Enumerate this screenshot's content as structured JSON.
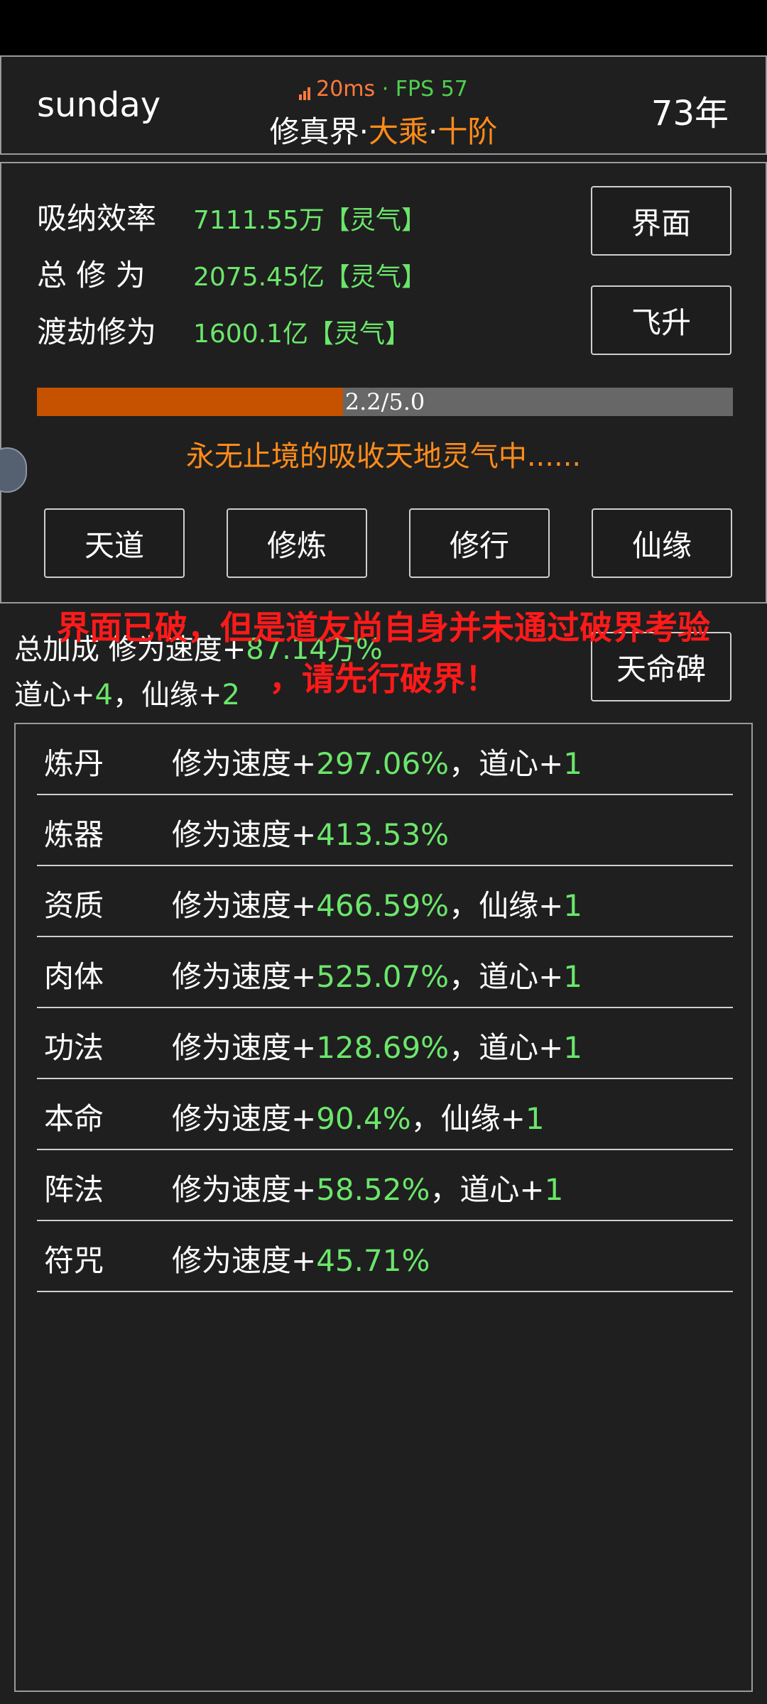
{
  "header": {
    "player_name": "sunday",
    "latency": "20ms",
    "fps_text": "· FPS 57",
    "realm_world": "修真界",
    "sep": "·",
    "realm_stage": "大乘",
    "realm_level": "十阶",
    "year": "73年"
  },
  "stats": [
    {
      "label": "吸纳效率",
      "value": "7111.55万【灵气】"
    },
    {
      "label": "总 修 为",
      "value": "2075.45亿【灵气】"
    },
    {
      "label": "渡劫修为",
      "value": "1600.1亿【灵气】"
    }
  ],
  "buttons": {
    "interface": "界面",
    "ascend": "飞升",
    "tiandao": "天道",
    "cultivate": "修炼",
    "practice": "修行",
    "fate": "仙缘",
    "tianming": "天命碑"
  },
  "progress": {
    "text": "2.2/5.0",
    "fraction": 0.44
  },
  "status_message": "永无止境的吸收天地灵气中......",
  "bonus": {
    "line1_label": "总加成 修为速度+",
    "line1_value": "87.14万%",
    "daoxin_label": "道心+",
    "daoxin_value": "4",
    "sep": "，",
    "xianyuan_label": "仙缘+",
    "xianyuan_value": "2"
  },
  "warning": {
    "line1": "界面已破，但是道友尚自身并未通过破界考验",
    "line2": "，请先行破界！"
  },
  "list": [
    {
      "cat": "炼丹",
      "label": "修为速度+",
      "pct": "297.06%",
      "extra_label": "，道心+",
      "extra_val": "1"
    },
    {
      "cat": "炼器",
      "label": "修为速度+",
      "pct": "413.53%",
      "extra_label": "",
      "extra_val": ""
    },
    {
      "cat": "资质",
      "label": "修为速度+",
      "pct": "466.59%",
      "extra_label": "，仙缘+",
      "extra_val": "1"
    },
    {
      "cat": "肉体",
      "label": "修为速度+",
      "pct": "525.07%",
      "extra_label": "，道心+",
      "extra_val": "1"
    },
    {
      "cat": "功法",
      "label": "修为速度+",
      "pct": "128.69%",
      "extra_label": "，道心+",
      "extra_val": "1"
    },
    {
      "cat": "本命",
      "label": "修为速度+",
      "pct": "90.4%",
      "extra_label": "，仙缘+",
      "extra_val": "1"
    },
    {
      "cat": "阵法",
      "label": "修为速度+",
      "pct": "58.52%",
      "extra_label": "，道心+",
      "extra_val": "1"
    },
    {
      "cat": "符咒",
      "label": "修为速度+",
      "pct": "45.71%",
      "extra_label": "",
      "extra_val": ""
    }
  ],
  "colors": {
    "accent_orange": "#ff8c1a",
    "value_green": "#6be66b",
    "warning_red": "#ff1a1a",
    "progress_fill": "#c65200"
  },
  "icons": [
    "signal-bars-icon"
  ]
}
